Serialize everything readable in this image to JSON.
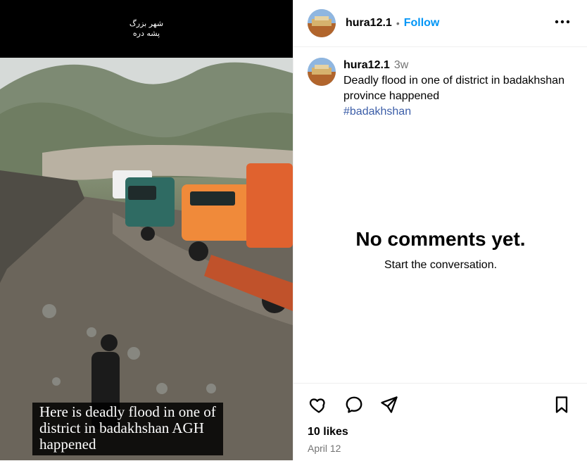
{
  "media": {
    "top_overlay_line1": "شهر بزرگ",
    "top_overlay_line2": "پشه دره",
    "caption": "Here is deadly flood in one of\ndistrict in badakhshan AGH\nhappened"
  },
  "header": {
    "username": "hura12.1",
    "separator": "•",
    "follow_label": "Follow",
    "more_icon": "more-horizontal-icon"
  },
  "post": {
    "username": "hura12.1",
    "time": "3w",
    "text": "Deadly flood in one of district in badakhshan province happened",
    "hashtag": "#badakhshan"
  },
  "comments": {
    "empty_title": "No comments yet.",
    "empty_subtitle": "Start the conversation."
  },
  "footer": {
    "likes": "10 likes",
    "date": "April 12",
    "icons": [
      "heart-icon",
      "comment-icon",
      "share-icon",
      "bookmark-icon"
    ]
  },
  "colors": {
    "accent": "#0095f6",
    "hashtag": "#3c5ea8",
    "muted": "#737373",
    "divider": "#efefef"
  }
}
